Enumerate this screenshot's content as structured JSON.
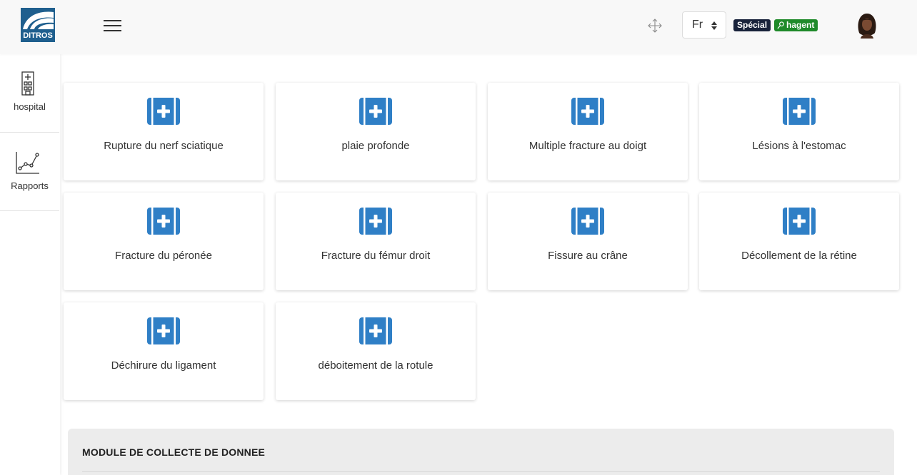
{
  "header": {
    "logo_text": "DITROS",
    "language": "Fr",
    "role_badge": "Spécial",
    "user_badge": "hagent"
  },
  "sidebar": {
    "items": [
      {
        "label": "hospital",
        "icon": "hospital-icon"
      },
      {
        "label": "Rapports",
        "icon": "chart-line-icon"
      }
    ]
  },
  "cards": [
    {
      "label": "Rupture du nerf sciatique"
    },
    {
      "label": "plaie profonde"
    },
    {
      "label": "Multiple fracture au doigt"
    },
    {
      "label": "Lésions à l'estomac"
    },
    {
      "label": "Fracture du péronée"
    },
    {
      "label": "Fracture du fémur droit"
    },
    {
      "label": "Fissure au crâne"
    },
    {
      "label": "Décollement de la rétine"
    },
    {
      "label": "Déchirure du ligament"
    },
    {
      "label": "déboitement de la rotule"
    }
  ],
  "module": {
    "title": "MODULE DE COLLECTE DE DONNEE"
  },
  "colors": {
    "accent": "#2f7fc6",
    "badge_dark": "#18223a",
    "badge_green": "#1f8a2a"
  }
}
